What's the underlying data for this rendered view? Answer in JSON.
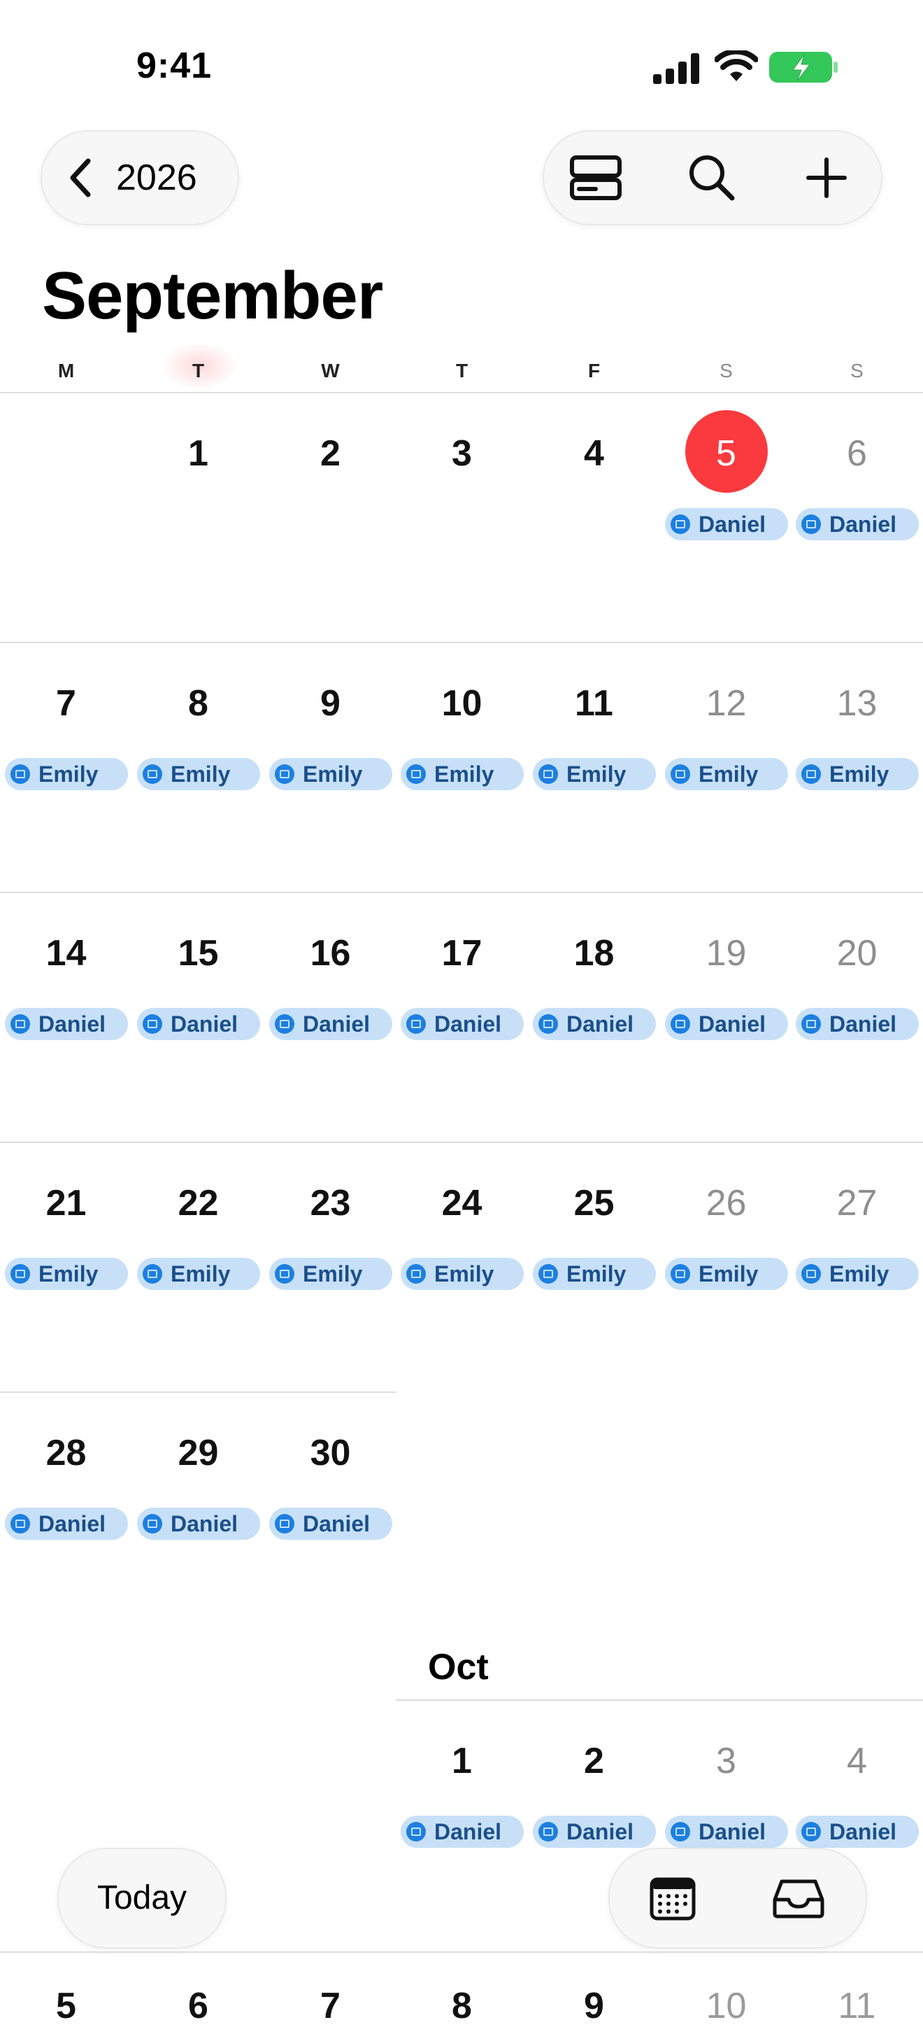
{
  "status": {
    "time": "9:41"
  },
  "nav": {
    "back_label": "2026"
  },
  "month": {
    "title": "September"
  },
  "weekdays": [
    "M",
    "T",
    "W",
    "T",
    "F",
    "S",
    "S"
  ],
  "next_month_label": "Oct",
  "today_button": "Today",
  "colors": {
    "accent": "#fa3a3f",
    "chip_bg": "#c7e0f8",
    "chip_text": "#1a4f8a",
    "chip_icon": "#1c7fe0"
  },
  "icons": {
    "status": [
      "cellular-signal-icon",
      "wifi-icon",
      "battery-charging-icon"
    ],
    "toolbar": [
      "list-view-icon",
      "search-icon",
      "add-icon"
    ],
    "bottom": [
      "calendar-icon",
      "inbox-icon"
    ],
    "back": "chevron-left-icon",
    "chip": "calendar-event-icon"
  },
  "weeks": [
    {
      "days": [
        null,
        {
          "day": "1"
        },
        {
          "day": "2"
        },
        {
          "day": "3"
        },
        {
          "day": "4"
        },
        {
          "day": "5",
          "event": "Daniel",
          "today": true
        },
        {
          "day": "6",
          "event": "Daniel"
        }
      ]
    },
    {
      "days": [
        {
          "day": "7",
          "event": "Emily"
        },
        {
          "day": "8",
          "event": "Emily"
        },
        {
          "day": "9",
          "event": "Emily"
        },
        {
          "day": "10",
          "event": "Emily"
        },
        {
          "day": "11",
          "event": "Emily"
        },
        {
          "day": "12",
          "event": "Emily"
        },
        {
          "day": "13",
          "event": "Emily"
        }
      ]
    },
    {
      "days": [
        {
          "day": "14",
          "event": "Daniel"
        },
        {
          "day": "15",
          "event": "Daniel"
        },
        {
          "day": "16",
          "event": "Daniel"
        },
        {
          "day": "17",
          "event": "Daniel"
        },
        {
          "day": "18",
          "event": "Daniel"
        },
        {
          "day": "19",
          "event": "Daniel"
        },
        {
          "day": "20",
          "event": "Daniel"
        }
      ]
    },
    {
      "days": [
        {
          "day": "21",
          "event": "Emily"
        },
        {
          "day": "22",
          "event": "Emily"
        },
        {
          "day": "23",
          "event": "Emily"
        },
        {
          "day": "24",
          "event": "Emily"
        },
        {
          "day": "25",
          "event": "Emily"
        },
        {
          "day": "26",
          "event": "Emily"
        },
        {
          "day": "27",
          "event": "Emily"
        }
      ]
    },
    {
      "days": [
        {
          "day": "28",
          "event": "Daniel"
        },
        {
          "day": "29",
          "event": "Daniel"
        },
        {
          "day": "30",
          "event": "Daniel"
        },
        null,
        null,
        null,
        null
      ]
    }
  ],
  "oct_week": {
    "days": [
      null,
      null,
      null,
      {
        "day": "1",
        "event": "Daniel"
      },
      {
        "day": "2",
        "event": "Daniel"
      },
      {
        "day": "3",
        "event": "Daniel"
      },
      {
        "day": "4",
        "event": "Daniel"
      }
    ]
  },
  "peek_week": [
    "5",
    "6",
    "7",
    "8",
    "9",
    "10",
    "11"
  ]
}
